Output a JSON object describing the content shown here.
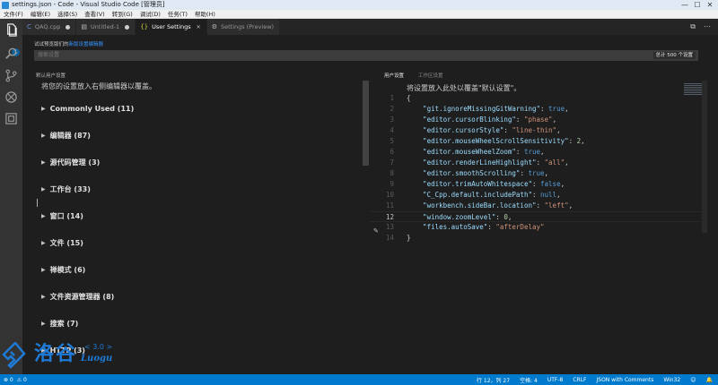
{
  "window": {
    "title": "settings.json - Code - Visual Studio Code [管理员]",
    "controls": {
      "minimize": "—",
      "maximize": "☐",
      "close": "✕"
    }
  },
  "menu": [
    "文件(F)",
    "编辑(E)",
    "选择(S)",
    "查看(V)",
    "转到(G)",
    "调试(D)",
    "任务(T)",
    "帮助(H)"
  ],
  "activity": {
    "items": [
      {
        "name": "explorer",
        "icon": "files-icon"
      },
      {
        "name": "search",
        "icon": "search-icon"
      },
      {
        "name": "source-control",
        "icon": "git-branch-icon"
      },
      {
        "name": "debug",
        "icon": "bug-icon"
      },
      {
        "name": "extensions",
        "icon": "extensions-icon"
      }
    ],
    "badge": "1"
  },
  "tabs": [
    {
      "label": "QAQ.cpp",
      "icon": "c-file-icon",
      "state": "dot"
    },
    {
      "label": "Untitled-1",
      "icon": "file-icon",
      "state": "dot"
    },
    {
      "label": "User Settings",
      "icon": "json-icon",
      "state": "close"
    },
    {
      "label": "Settings (Preview)",
      "icon": "gear-icon",
      "state": "none"
    }
  ],
  "tab_actions": {
    "split": "⧉",
    "more": "⋯"
  },
  "topline": {
    "text": "试试预览版们的",
    "link": "新版设置编辑器"
  },
  "search": {
    "placeholder": "搜索设置",
    "count": "总计 500 个设置"
  },
  "left": {
    "header": "默认用户设置",
    "description": "将您的设置放入右侧编辑器以覆盖。",
    "groups": [
      "Commonly Used (11)",
      "编辑器 (87)",
      "源代码管理 (3)",
      "工作台 (33)",
      "窗口 (14)",
      "文件 (15)",
      "禅模式 (6)",
      "文件资源管理器 (8)",
      "搜索 (7)",
      "HTTP (3)"
    ]
  },
  "right": {
    "tabs": [
      "用户设置",
      "工作区设置"
    ],
    "description": "将设置放入此处以覆盖\"默认设置\"。",
    "current_line": 12,
    "lines": [
      {
        "n": "1",
        "tokens": [
          {
            "t": "p",
            "v": "{"
          }
        ]
      },
      {
        "n": "2",
        "tokens": [
          {
            "t": "k",
            "v": "    \"git.ignoreMissingGitWarning\""
          },
          {
            "t": "p",
            "v": ": "
          },
          {
            "t": "b",
            "v": "true"
          },
          {
            "t": "p",
            "v": ","
          }
        ]
      },
      {
        "n": "3",
        "tokens": [
          {
            "t": "k",
            "v": "    \"editor.cursorBlinking\""
          },
          {
            "t": "p",
            "v": ": "
          },
          {
            "t": "s",
            "v": "\"phase\""
          },
          {
            "t": "p",
            "v": ","
          }
        ]
      },
      {
        "n": "4",
        "tokens": [
          {
            "t": "k",
            "v": "    \"editor.cursorStyle\""
          },
          {
            "t": "p",
            "v": ": "
          },
          {
            "t": "s",
            "v": "\"line-thin\""
          },
          {
            "t": "p",
            "v": ","
          }
        ]
      },
      {
        "n": "5",
        "tokens": [
          {
            "t": "k",
            "v": "    \"editor.mouseWheelScrollSensitivity\""
          },
          {
            "t": "p",
            "v": ": "
          },
          {
            "t": "n",
            "v": "2"
          },
          {
            "t": "p",
            "v": ","
          }
        ]
      },
      {
        "n": "6",
        "tokens": [
          {
            "t": "k",
            "v": "    \"editor.mouseWheelZoom\""
          },
          {
            "t": "p",
            "v": ": "
          },
          {
            "t": "b",
            "v": "true"
          },
          {
            "t": "p",
            "v": ","
          }
        ]
      },
      {
        "n": "7",
        "tokens": [
          {
            "t": "k",
            "v": "    \"editor.renderLineHighlight\""
          },
          {
            "t": "p",
            "v": ": "
          },
          {
            "t": "s",
            "v": "\"all\""
          },
          {
            "t": "p",
            "v": ","
          }
        ]
      },
      {
        "n": "8",
        "tokens": [
          {
            "t": "k",
            "v": "    \"editor.smoothScrolling\""
          },
          {
            "t": "p",
            "v": ": "
          },
          {
            "t": "b",
            "v": "true"
          },
          {
            "t": "p",
            "v": ","
          }
        ]
      },
      {
        "n": "9",
        "tokens": [
          {
            "t": "k",
            "v": "    \"editor.trimAutoWhitespace\""
          },
          {
            "t": "p",
            "v": ": "
          },
          {
            "t": "b",
            "v": "false"
          },
          {
            "t": "p",
            "v": ","
          }
        ]
      },
      {
        "n": "10",
        "tokens": [
          {
            "t": "k",
            "v": "    \"C_Cpp.default.includePath\""
          },
          {
            "t": "p",
            "v": ": "
          },
          {
            "t": "b",
            "v": "null"
          },
          {
            "t": "p",
            "v": ","
          }
        ]
      },
      {
        "n": "11",
        "tokens": [
          {
            "t": "k",
            "v": "    \"workbench.sideBar.location\""
          },
          {
            "t": "p",
            "v": ": "
          },
          {
            "t": "s",
            "v": "\"left\""
          },
          {
            "t": "p",
            "v": ","
          }
        ]
      },
      {
        "n": "12",
        "tokens": [
          {
            "t": "k",
            "v": "    \"window.zoomLevel\""
          },
          {
            "t": "p",
            "v": ": "
          },
          {
            "t": "n",
            "v": "0"
          },
          {
            "t": "p",
            "v": ","
          }
        ]
      },
      {
        "n": "13",
        "tokens": [
          {
            "t": "k",
            "v": "    \"files.autoSave\""
          },
          {
            "t": "p",
            "v": ": "
          },
          {
            "t": "s",
            "v": "\"afterDelay\""
          }
        ]
      },
      {
        "n": "14",
        "tokens": [
          {
            "t": "p",
            "v": "}"
          }
        ]
      }
    ]
  },
  "watermark": {
    "cn": "洛谷",
    "version": "< 3.0 >",
    "en": "Luogu"
  },
  "status": {
    "left": {
      "errors": "⊗ 0",
      "warnings": "⚠ 0"
    },
    "right": [
      "行 12，列 27",
      "空格: 4",
      "UTF-8",
      "CRLF",
      "JSON with Comments",
      "Win32",
      "☺",
      "🔔"
    ]
  },
  "colors": {
    "accent": "#007acc",
    "key": "#9cdcfe",
    "string": "#ce9178",
    "number": "#b5cea8",
    "keyword": "#569cd6"
  }
}
